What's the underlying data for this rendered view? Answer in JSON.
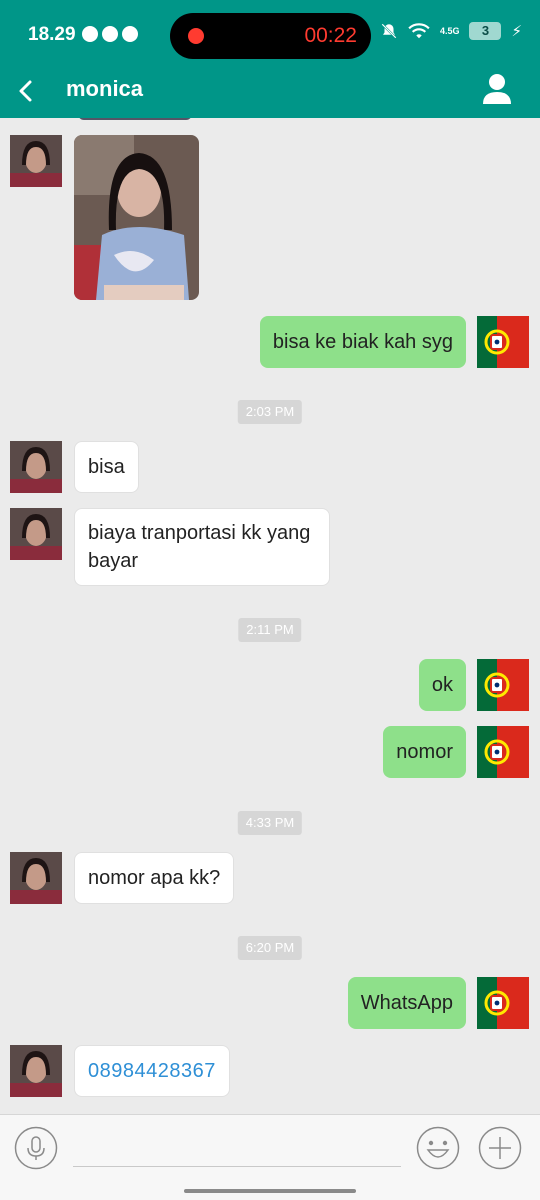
{
  "status_bar": {
    "time": "18.29",
    "recording_timer": "00:22",
    "network": "4.5G",
    "battery": "3"
  },
  "header": {
    "back_icon": "chevron-left-icon",
    "title": "monica",
    "profile_icon": "person-icon"
  },
  "messages": [
    {
      "type": "image",
      "direction": "in"
    },
    {
      "type": "text",
      "direction": "out",
      "text": "bisa ke biak kah syg"
    },
    {
      "type": "timestamp",
      "text": "2:03 PM"
    },
    {
      "type": "text",
      "direction": "in",
      "text": "bisa"
    },
    {
      "type": "text",
      "direction": "in",
      "text": "biaya tranportasi kk yang bayar"
    },
    {
      "type": "timestamp",
      "text": "2:11 PM"
    },
    {
      "type": "text",
      "direction": "out",
      "text": "ok"
    },
    {
      "type": "text",
      "direction": "out",
      "text": "nomor"
    },
    {
      "type": "timestamp",
      "text": "4:33 PM"
    },
    {
      "type": "text",
      "direction": "in",
      "text": "nomor apa kk?"
    },
    {
      "type": "timestamp",
      "text": "6:20 PM"
    },
    {
      "type": "text",
      "direction": "out",
      "text": "WhatsApp"
    },
    {
      "type": "text",
      "direction": "in",
      "text": "08984428367"
    }
  ],
  "input_bar": {
    "placeholder": "",
    "voice_icon": "microphone-icon",
    "emoji_icon": "emoji-icon",
    "more_icon": "plus-icon"
  },
  "colors": {
    "header": "#009688",
    "outgoing_bubble": "#8ee08a",
    "incoming_bubble": "#ffffff",
    "background": "#ebebeb",
    "link": "#2e8fd6"
  }
}
